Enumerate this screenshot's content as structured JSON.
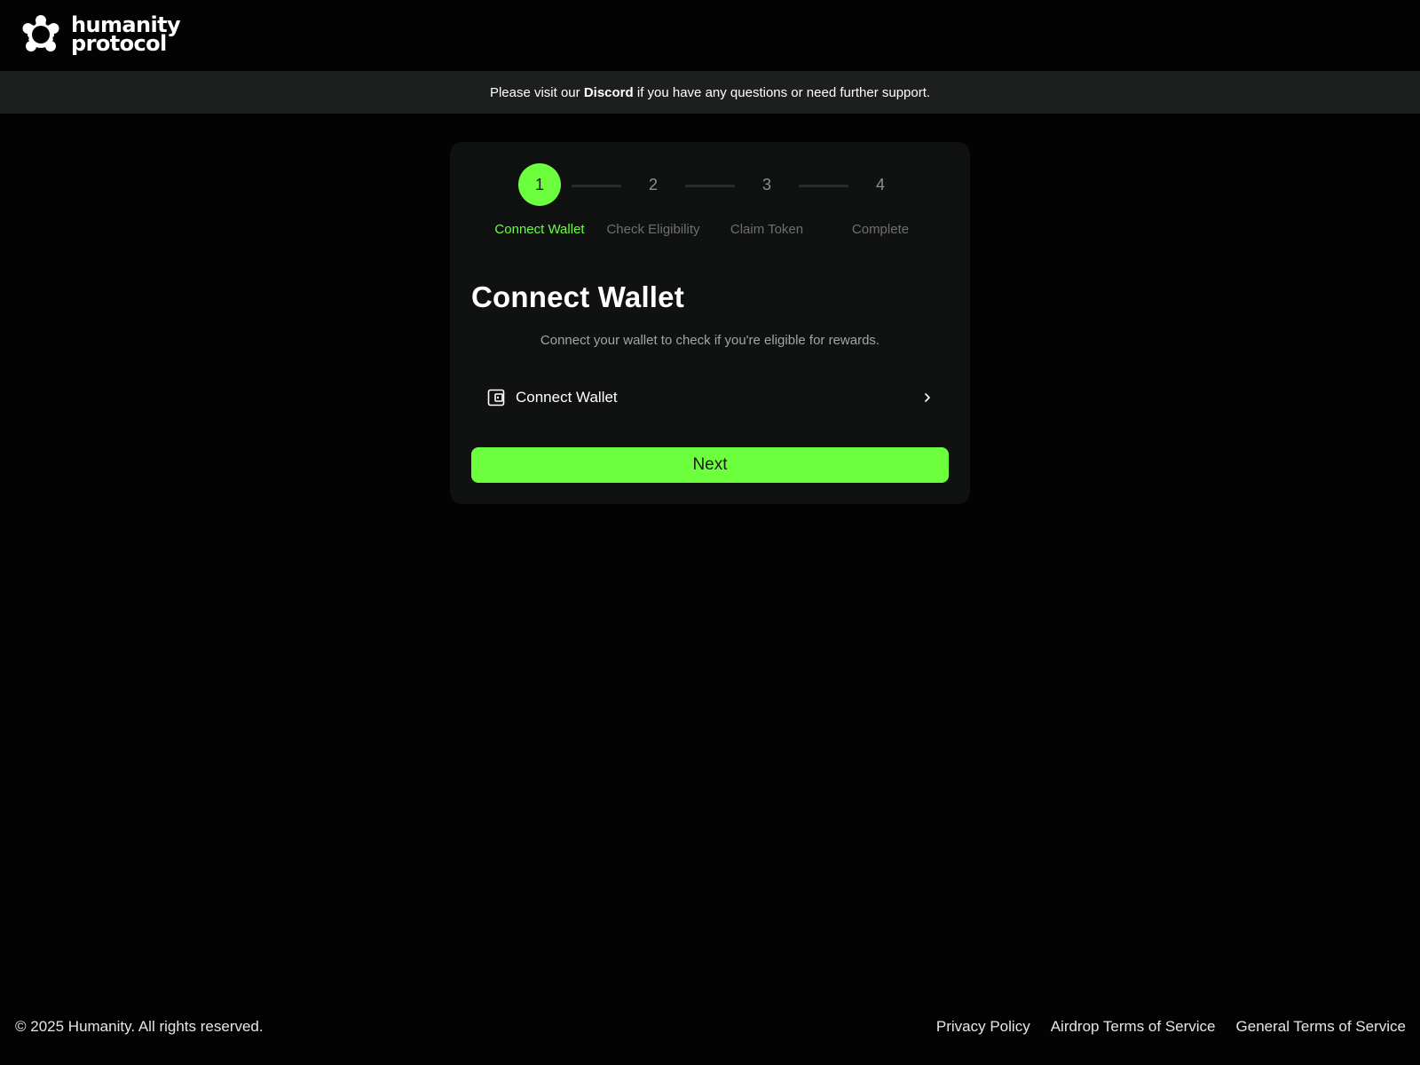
{
  "header": {
    "logo_line1": "humanity",
    "logo_line2": "protocol"
  },
  "banner": {
    "before": "Please visit our ",
    "link": "Discord",
    "after": " if you have any questions or need further support."
  },
  "stepper": {
    "steps": [
      {
        "number": "1",
        "label": "Connect Wallet",
        "state": "active"
      },
      {
        "number": "2",
        "label": "Check Eligibility",
        "state": "inactive"
      },
      {
        "number": "3",
        "label": "Claim Token",
        "state": "inactive"
      },
      {
        "number": "4",
        "label": "Complete",
        "state": "inactive"
      }
    ]
  },
  "card": {
    "title": "Connect Wallet",
    "subtitle": "Connect your wallet to check if you're eligible for rewards.",
    "connect_option": {
      "icon": "wallet-icon",
      "label": "Connect Wallet",
      "trailing_icon": "chevron-right-icon"
    },
    "next_label": "Next"
  },
  "footer": {
    "copyright": "© 2025 Humanity. All rights reserved.",
    "links": [
      "Privacy Policy",
      "Airdrop Terms of Service",
      "General Terms of Service"
    ]
  },
  "colors": {
    "accent": "#6bff3e",
    "background": "#030303",
    "banner": "#1d1e1e",
    "card": "#101111"
  }
}
